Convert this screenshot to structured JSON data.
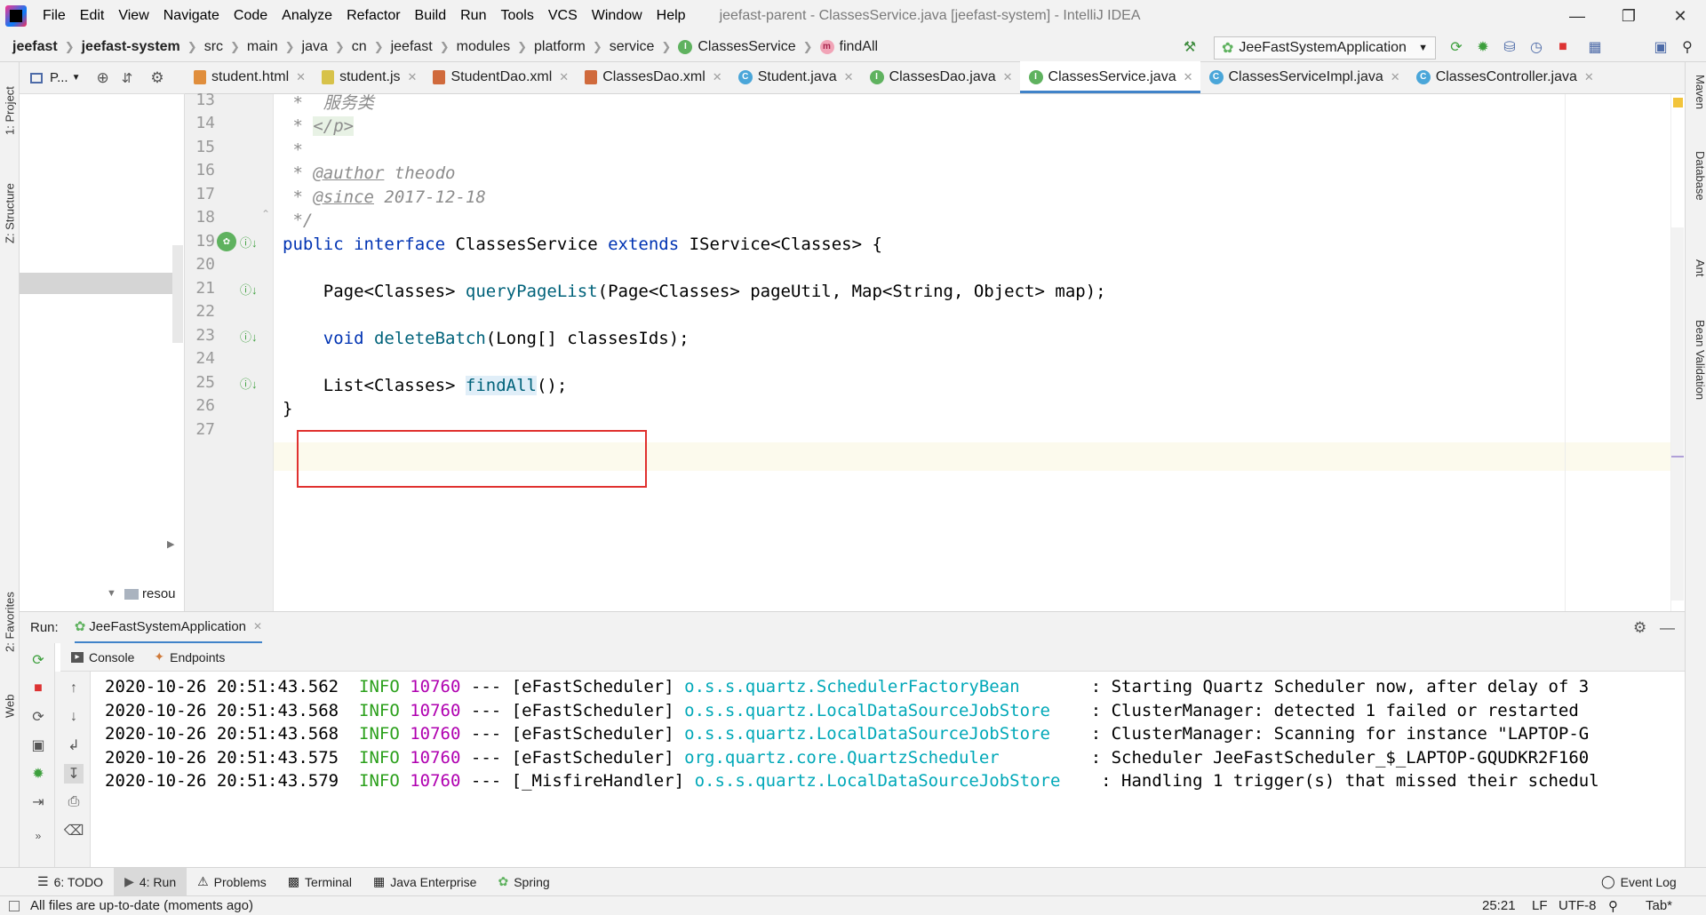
{
  "menu": {
    "items": [
      "File",
      "Edit",
      "View",
      "Navigate",
      "Code",
      "Analyze",
      "Refactor",
      "Build",
      "Run",
      "Tools",
      "VCS",
      "Window",
      "Help"
    ],
    "window_title": "jeefast-parent - ClassesService.java [jeefast-system] - IntelliJ IDEA"
  },
  "breadcrumb": {
    "items": [
      "jeefast",
      "jeefast-system",
      "src",
      "main",
      "java",
      "cn",
      "jeefast",
      "modules",
      "platform",
      "service"
    ],
    "class_name": "ClassesService",
    "method_name": "findAll",
    "run_config": "JeeFastSystemApplication"
  },
  "left_strip": {
    "project": "1: Project",
    "structure": "Z: Structure",
    "favorites": "2: Favorites",
    "web": "Web"
  },
  "right_strip": {
    "maven": "Maven",
    "database": "Database",
    "ant": "Ant",
    "bean_validation": "Bean Validation"
  },
  "project_panel": {
    "title": "P...",
    "tree_item": "resou"
  },
  "tabs": [
    {
      "label": "student.html",
      "icon": "html-file-icon",
      "active": false
    },
    {
      "label": "student.js",
      "icon": "js-file-icon",
      "active": false
    },
    {
      "label": "StudentDao.xml",
      "icon": "xml-file-icon",
      "active": false
    },
    {
      "label": "ClassesDao.xml",
      "icon": "xml-file-icon",
      "active": false
    },
    {
      "label": "Student.java",
      "icon": "class-icon",
      "active": false
    },
    {
      "label": "ClassesDao.java",
      "icon": "interface-icon",
      "active": false
    },
    {
      "label": "ClassesService.java",
      "icon": "interface-icon",
      "active": true
    },
    {
      "label": "ClassesServiceImpl.java",
      "icon": "class-icon",
      "active": false
    },
    {
      "label": "ClassesController.java",
      "icon": "class-icon",
      "active": false
    }
  ],
  "editor": {
    "line_numbers": [
      "13",
      "14",
      "15",
      "16",
      "17",
      "18",
      "19",
      "20",
      "21",
      "22",
      "23",
      "24",
      "25",
      "26",
      "27"
    ],
    "lines": {
      "l13": " *  服务类",
      "l14a": " * ",
      "l14b": "</p>",
      "l15": " *",
      "l16a": " * ",
      "l16b": "@author",
      "l16c": " theodo",
      "l17a": " * ",
      "l17b": "@since",
      "l17c": " 2017-12-18",
      "l18": " */",
      "l19_kw1": "public",
      "l19_kw2": "interface",
      "l19_name": " ClassesService ",
      "l19_kw3": "extends",
      "l19_rest": " IService<Classes> {",
      "l21_type": "    Page<Classes> ",
      "l21_method": "queryPageList",
      "l21_rest": "(Page<Classes> pageUtil, Map<String, Object> map);",
      "l23_kw": "    void ",
      "l23_method": "deleteBatch",
      "l23_rest": "(Long[] classesIds);",
      "l25_type": "    List<Classes> ",
      "l25_method": "findAll",
      "l25_rest": "();",
      "l26": "}"
    }
  },
  "run_panel": {
    "label": "Run:",
    "app_tab": "JeeFastSystemApplication",
    "console_tab": "Console",
    "endpoints_tab": "Endpoints",
    "logs": [
      {
        "ts": "2020-10-26 20:51:43.562",
        "level": "INFO",
        "pid": "10760",
        "sep": "---",
        "thread": "[eFastScheduler]",
        "logger": "o.s.s.quartz.SchedulerFactoryBean",
        "msg": ": Starting Quartz Scheduler now, after delay of 3"
      },
      {
        "ts": "2020-10-26 20:51:43.568",
        "level": "INFO",
        "pid": "10760",
        "sep": "---",
        "thread": "[eFastScheduler]",
        "logger": "o.s.s.quartz.LocalDataSourceJobStore",
        "msg": ": ClusterManager: detected 1 failed or restarted"
      },
      {
        "ts": "2020-10-26 20:51:43.568",
        "level": "INFO",
        "pid": "10760",
        "sep": "---",
        "thread": "[eFastScheduler]",
        "logger": "o.s.s.quartz.LocalDataSourceJobStore",
        "msg": ": ClusterManager: Scanning for instance \"LAPTOP-G"
      },
      {
        "ts": "2020-10-26 20:51:43.575",
        "level": "INFO",
        "pid": "10760",
        "sep": "---",
        "thread": "[eFastScheduler]",
        "logger": "org.quartz.core.QuartzScheduler",
        "msg": ": Scheduler JeeFastScheduler_$_LAPTOP-GQUDKR2F160"
      },
      {
        "ts": "2020-10-26 20:51:43.579",
        "level": "INFO",
        "pid": "10760",
        "sep": "---",
        "thread": "[_MisfireHandler]",
        "logger": "o.s.s.quartz.LocalDataSourceJobStore",
        "msg": ": Handling 1 trigger(s) that missed their schedul"
      }
    ]
  },
  "bottom_tabs": {
    "todo": "6: TODO",
    "run": "4: Run",
    "problems": "Problems",
    "terminal": "Terminal",
    "java_enterprise": "Java Enterprise",
    "spring": "Spring",
    "event_log": "Event Log"
  },
  "status": {
    "message": "All files are up-to-date (moments ago)",
    "position": "25:21",
    "line_sep": "LF",
    "encoding": "UTF-8",
    "indent": "Tab*"
  },
  "colors": {
    "highlight_box": "#e0312f",
    "keyword": "#0033b3",
    "method": "#00627a",
    "log_info": "#2ba01b",
    "log_pid": "#b000b0",
    "log_logger": "#00a8b8"
  }
}
